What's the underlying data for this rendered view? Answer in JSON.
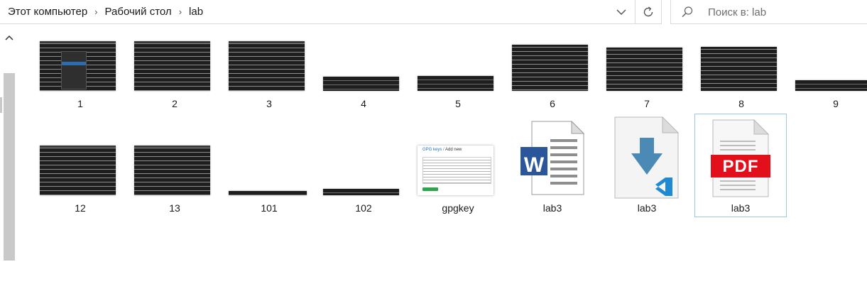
{
  "address_bar": {
    "breadcrumb": [
      "Этот компьютер",
      "Рабочий стол",
      "lab"
    ]
  },
  "search": {
    "placeholder": "Поиск в: lab"
  },
  "icons": {
    "separator": "chevron-right-icon",
    "dropdown": "chevron-down-icon",
    "refresh": "refresh-icon",
    "search": "search-icon",
    "scroll_up": "chevron-up-icon"
  },
  "files": [
    {
      "name": "1",
      "type": "image"
    },
    {
      "name": "2",
      "type": "image"
    },
    {
      "name": "3",
      "type": "image"
    },
    {
      "name": "4",
      "type": "image"
    },
    {
      "name": "5",
      "type": "image"
    },
    {
      "name": "6",
      "type": "image"
    },
    {
      "name": "7",
      "type": "image"
    },
    {
      "name": "8",
      "type": "image"
    },
    {
      "name": "9",
      "type": "image"
    },
    {
      "name": "12",
      "type": "image"
    },
    {
      "name": "13",
      "type": "image"
    },
    {
      "name": "101",
      "type": "image"
    },
    {
      "name": "102",
      "type": "image"
    },
    {
      "name": "gpgkey",
      "type": "image"
    },
    {
      "name": "lab3",
      "type": "word-document"
    },
    {
      "name": "lab3",
      "type": "vscode-file"
    },
    {
      "name": "lab3",
      "type": "pdf-document",
      "selected": true
    }
  ],
  "gpg_thumb": {
    "title": "GPG keys",
    "subtitle": "Add new"
  },
  "pdf_badge": "PDF",
  "word_badge": "W",
  "colors": {
    "selection_border": "#99c9ea",
    "word_blue": "#2b579a",
    "pdf_red": "#e1101a",
    "vscode_arrow": "#4a8ab5",
    "vscode_logo": "#1f8ad2"
  }
}
